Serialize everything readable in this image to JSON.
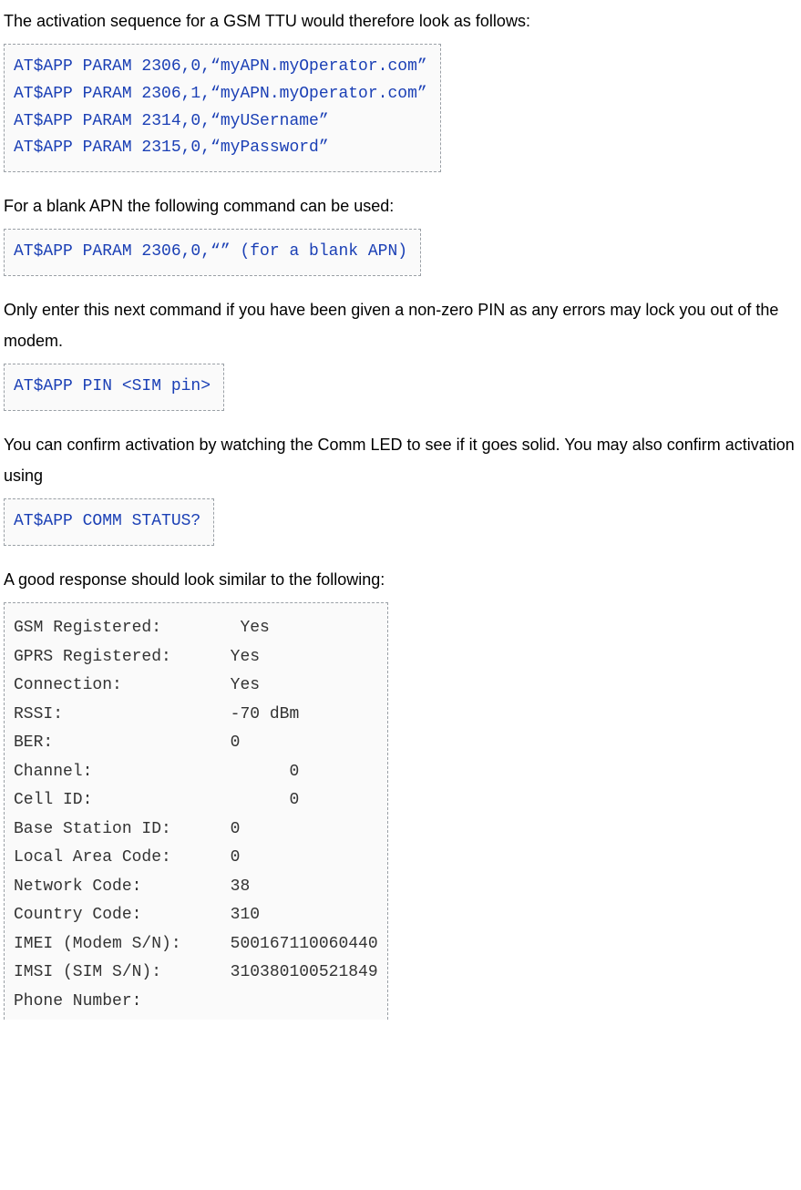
{
  "paragraphs": {
    "p1": "The activation sequence for a GSM TTU would therefore look as follows:",
    "p2": "For a blank APN the following command can be used:",
    "p3": "Only enter this next command if you have been given a non-zero PIN as any errors may lock you out of the modem.",
    "p4": "You can confirm activation by watching the Comm LED to see if it goes solid. You may also confirm activation using",
    "p5": "A good response should look similar to the following:"
  },
  "code": {
    "block1": {
      "l1": "AT$APP PARAM 2306,0,“myAPN.myOperator.com”",
      "l2": "AT$APP PARAM 2306,1,“myAPN.myOperator.com”",
      "l3": "AT$APP PARAM 2314,0,“myUSername”",
      "l4": "AT$APP PARAM 2315,0,“myPassword”"
    },
    "block2": {
      "l1": "AT$APP PARAM 2306,0,“” (for a blank APN)"
    },
    "block3": {
      "l1": "AT$APP PIN <SIM pin>"
    },
    "block4": {
      "l1": "AT$APP COMM STATUS?"
    },
    "status": {
      "l1": "GSM Registered:        Yes",
      "l2": "GPRS Registered:      Yes",
      "l3": "Connection:           Yes",
      "l4": "RSSI:                 -70 dBm",
      "l5": "BER:                  0",
      "l6": "Channel:                    0",
      "l7": "Cell ID:                    0",
      "l8": "Base Station ID:      0",
      "l9": "Local Area Code:      0",
      "l10": "Network Code:         38",
      "l11": "Country Code:         310",
      "l12": "IMEI (Modem S/N):     500167110060440",
      "l13": "IMSI (SIM S/N):       310380100521849",
      "l14": "Phone Number:"
    }
  }
}
